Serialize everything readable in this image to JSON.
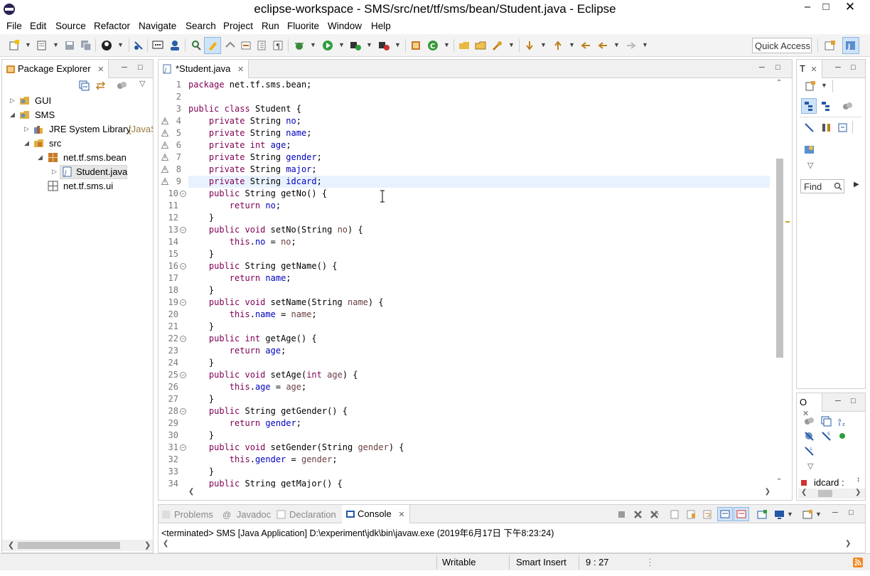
{
  "window": {
    "title": "eclipse-workspace - SMS/src/net/tf/sms/bean/Student.java - Eclipse"
  },
  "menu": [
    "File",
    "Edit",
    "Source",
    "Refactor",
    "Navigate",
    "Search",
    "Project",
    "Run",
    "Fluorite",
    "Window",
    "Help"
  ],
  "toolbar": {
    "quick_access": "Quick Access"
  },
  "package_explorer": {
    "title": "Package Explorer",
    "tree": [
      {
        "label": "GUI"
      },
      {
        "label": "SMS"
      },
      {
        "label": "JRE System Library",
        "suffix": "[JavaS"
      },
      {
        "label": "src"
      },
      {
        "label": "net.tf.sms.bean"
      },
      {
        "label": "Student.java"
      },
      {
        "label": "net.tf.sms.ui"
      }
    ]
  },
  "editor": {
    "tab_title": "*Student.java",
    "lines": [
      [
        [
          "k",
          "package"
        ],
        [
          "t",
          " net.tf.sms.bean;"
        ]
      ],
      [],
      [
        [
          "k",
          "public"
        ],
        [
          "t",
          " "
        ],
        [
          "k",
          "class"
        ],
        [
          "t",
          " Student {"
        ]
      ],
      [
        [
          "t",
          "    "
        ],
        [
          "k",
          "private"
        ],
        [
          "t",
          " String "
        ],
        [
          "f",
          "no"
        ],
        [
          "t",
          ";"
        ]
      ],
      [
        [
          "t",
          "    "
        ],
        [
          "k",
          "private"
        ],
        [
          "t",
          " String "
        ],
        [
          "f",
          "name"
        ],
        [
          "t",
          ";"
        ]
      ],
      [
        [
          "t",
          "    "
        ],
        [
          "k",
          "private"
        ],
        [
          "t",
          " "
        ],
        [
          "k",
          "int"
        ],
        [
          "t",
          " "
        ],
        [
          "f",
          "age"
        ],
        [
          "t",
          ";"
        ]
      ],
      [
        [
          "t",
          "    "
        ],
        [
          "k",
          "private"
        ],
        [
          "t",
          " String "
        ],
        [
          "f",
          "gender"
        ],
        [
          "t",
          ";"
        ]
      ],
      [
        [
          "t",
          "    "
        ],
        [
          "k",
          "private"
        ],
        [
          "t",
          " String "
        ],
        [
          "f",
          "major"
        ],
        [
          "t",
          ";"
        ]
      ],
      [
        [
          "t",
          "    "
        ],
        [
          "k",
          "private"
        ],
        [
          "t",
          " String "
        ],
        [
          "f",
          "idcard"
        ],
        [
          "t",
          ";"
        ]
      ],
      [
        [
          "t",
          "    "
        ],
        [
          "k",
          "public"
        ],
        [
          "t",
          " String getNo() {"
        ]
      ],
      [
        [
          "t",
          "        "
        ],
        [
          "k",
          "return"
        ],
        [
          "t",
          " "
        ],
        [
          "f",
          "no"
        ],
        [
          "t",
          ";"
        ]
      ],
      [
        [
          "t",
          "    }"
        ]
      ],
      [
        [
          "t",
          "    "
        ],
        [
          "k",
          "public"
        ],
        [
          "t",
          " "
        ],
        [
          "k",
          "void"
        ],
        [
          "t",
          " setNo(String "
        ],
        [
          "p",
          "no"
        ],
        [
          "t",
          ") {"
        ]
      ],
      [
        [
          "t",
          "        "
        ],
        [
          "k",
          "this"
        ],
        [
          "t",
          "."
        ],
        [
          "f",
          "no"
        ],
        [
          "t",
          " = "
        ],
        [
          "p",
          "no"
        ],
        [
          "t",
          ";"
        ]
      ],
      [
        [
          "t",
          "    }"
        ]
      ],
      [
        [
          "t",
          "    "
        ],
        [
          "k",
          "public"
        ],
        [
          "t",
          " String getName() {"
        ]
      ],
      [
        [
          "t",
          "        "
        ],
        [
          "k",
          "return"
        ],
        [
          "t",
          " "
        ],
        [
          "f",
          "name"
        ],
        [
          "t",
          ";"
        ]
      ],
      [
        [
          "t",
          "    }"
        ]
      ],
      [
        [
          "t",
          "    "
        ],
        [
          "k",
          "public"
        ],
        [
          "t",
          " "
        ],
        [
          "k",
          "void"
        ],
        [
          "t",
          " setName(String "
        ],
        [
          "p",
          "name"
        ],
        [
          "t",
          ") {"
        ]
      ],
      [
        [
          "t",
          "        "
        ],
        [
          "k",
          "this"
        ],
        [
          "t",
          "."
        ],
        [
          "f",
          "name"
        ],
        [
          "t",
          " = "
        ],
        [
          "p",
          "name"
        ],
        [
          "t",
          ";"
        ]
      ],
      [
        [
          "t",
          "    }"
        ]
      ],
      [
        [
          "t",
          "    "
        ],
        [
          "k",
          "public"
        ],
        [
          "t",
          " "
        ],
        [
          "k",
          "int"
        ],
        [
          "t",
          " getAge() {"
        ]
      ],
      [
        [
          "t",
          "        "
        ],
        [
          "k",
          "return"
        ],
        [
          "t",
          " "
        ],
        [
          "f",
          "age"
        ],
        [
          "t",
          ";"
        ]
      ],
      [
        [
          "t",
          "    }"
        ]
      ],
      [
        [
          "t",
          "    "
        ],
        [
          "k",
          "public"
        ],
        [
          "t",
          " "
        ],
        [
          "k",
          "void"
        ],
        [
          "t",
          " setAge("
        ],
        [
          "k",
          "int"
        ],
        [
          "t",
          " "
        ],
        [
          "p",
          "age"
        ],
        [
          "t",
          ") {"
        ]
      ],
      [
        [
          "t",
          "        "
        ],
        [
          "k",
          "this"
        ],
        [
          "t",
          "."
        ],
        [
          "f",
          "age"
        ],
        [
          "t",
          " = "
        ],
        [
          "p",
          "age"
        ],
        [
          "t",
          ";"
        ]
      ],
      [
        [
          "t",
          "    }"
        ]
      ],
      [
        [
          "t",
          "    "
        ],
        [
          "k",
          "public"
        ],
        [
          "t",
          " String getGender() {"
        ]
      ],
      [
        [
          "t",
          "        "
        ],
        [
          "k",
          "return"
        ],
        [
          "t",
          " "
        ],
        [
          "f",
          "gender"
        ],
        [
          "t",
          ";"
        ]
      ],
      [
        [
          "t",
          "    }"
        ]
      ],
      [
        [
          "t",
          "    "
        ],
        [
          "k",
          "public"
        ],
        [
          "t",
          " "
        ],
        [
          "k",
          "void"
        ],
        [
          "t",
          " setGender(String "
        ],
        [
          "p",
          "gender"
        ],
        [
          "t",
          ") {"
        ]
      ],
      [
        [
          "t",
          "        "
        ],
        [
          "k",
          "this"
        ],
        [
          "t",
          "."
        ],
        [
          "f",
          "gender"
        ],
        [
          "t",
          " = "
        ],
        [
          "p",
          "gender"
        ],
        [
          "t",
          ";"
        ]
      ],
      [
        [
          "t",
          "    }"
        ]
      ],
      [
        [
          "t",
          "    "
        ],
        [
          "k",
          "public"
        ],
        [
          "t",
          " String getMajor() {"
        ]
      ]
    ],
    "highlighted_line": 9
  },
  "right_top": {
    "tab": "T",
    "find_placeholder": "Find"
  },
  "right_bottom": {
    "tab": "O",
    "item": "idcard :"
  },
  "bottom_tabs": [
    "Problems",
    "Javadoc",
    "Declaration",
    "Console"
  ],
  "console_text": "<terminated> SMS [Java Application] D:\\experiment\\jdk\\bin\\javaw.exe (2019年6月17日 下午8:23:24)",
  "status": {
    "writable": "Writable",
    "insert_mode": "Smart Insert",
    "position": "9 : 27"
  },
  "colors": {
    "keyword": "#7f0055",
    "field": "#0000c0",
    "param": "#6a3e3e",
    "line_highlight": "#e8f2fe",
    "accent": "#1565c0"
  }
}
